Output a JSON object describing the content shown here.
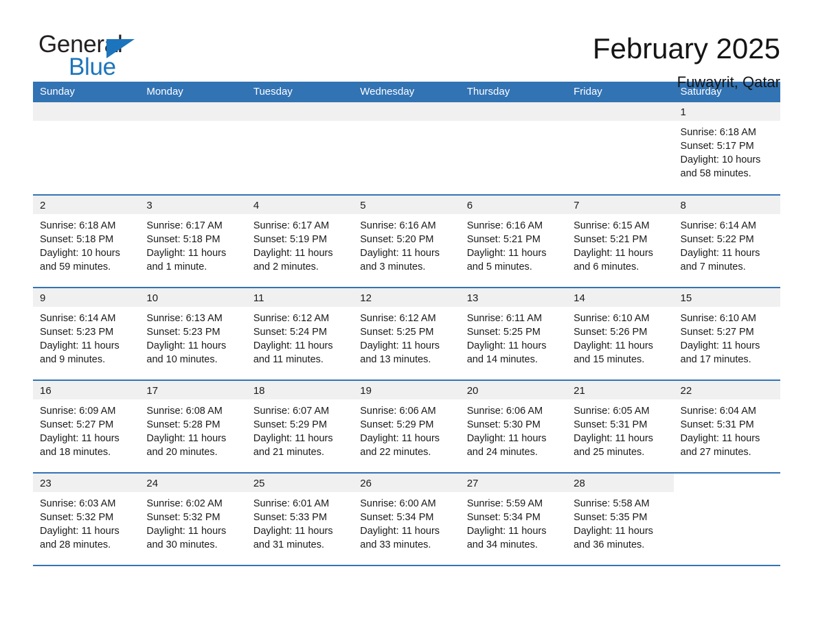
{
  "logo": {
    "word_top": "General",
    "word_bottom": "Blue",
    "accent_color": "#1c75bc"
  },
  "header": {
    "month_title": "February 2025",
    "location": "Fuwayrit, Qatar"
  },
  "theme": {
    "header_blue": "#3273b4",
    "daynum_band": "#f0f0f0",
    "text": "#1a1a1a"
  },
  "weekday_headers": [
    "Sunday",
    "Monday",
    "Tuesday",
    "Wednesday",
    "Thursday",
    "Friday",
    "Saturday"
  ],
  "weeks": [
    [
      {
        "day": "",
        "sunrise": "",
        "sunset": "",
        "daylight_line1": "",
        "daylight_line2": ""
      },
      {
        "day": "",
        "sunrise": "",
        "sunset": "",
        "daylight_line1": "",
        "daylight_line2": ""
      },
      {
        "day": "",
        "sunrise": "",
        "sunset": "",
        "daylight_line1": "",
        "daylight_line2": ""
      },
      {
        "day": "",
        "sunrise": "",
        "sunset": "",
        "daylight_line1": "",
        "daylight_line2": ""
      },
      {
        "day": "",
        "sunrise": "",
        "sunset": "",
        "daylight_line1": "",
        "daylight_line2": ""
      },
      {
        "day": "",
        "sunrise": "",
        "sunset": "",
        "daylight_line1": "",
        "daylight_line2": ""
      },
      {
        "day": "1",
        "sunrise": "Sunrise: 6:18 AM",
        "sunset": "Sunset: 5:17 PM",
        "daylight_line1": "Daylight: 10 hours",
        "daylight_line2": "and 58 minutes."
      }
    ],
    [
      {
        "day": "2",
        "sunrise": "Sunrise: 6:18 AM",
        "sunset": "Sunset: 5:18 PM",
        "daylight_line1": "Daylight: 10 hours",
        "daylight_line2": "and 59 minutes."
      },
      {
        "day": "3",
        "sunrise": "Sunrise: 6:17 AM",
        "sunset": "Sunset: 5:18 PM",
        "daylight_line1": "Daylight: 11 hours",
        "daylight_line2": "and 1 minute."
      },
      {
        "day": "4",
        "sunrise": "Sunrise: 6:17 AM",
        "sunset": "Sunset: 5:19 PM",
        "daylight_line1": "Daylight: 11 hours",
        "daylight_line2": "and 2 minutes."
      },
      {
        "day": "5",
        "sunrise": "Sunrise: 6:16 AM",
        "sunset": "Sunset: 5:20 PM",
        "daylight_line1": "Daylight: 11 hours",
        "daylight_line2": "and 3 minutes."
      },
      {
        "day": "6",
        "sunrise": "Sunrise: 6:16 AM",
        "sunset": "Sunset: 5:21 PM",
        "daylight_line1": "Daylight: 11 hours",
        "daylight_line2": "and 5 minutes."
      },
      {
        "day": "7",
        "sunrise": "Sunrise: 6:15 AM",
        "sunset": "Sunset: 5:21 PM",
        "daylight_line1": "Daylight: 11 hours",
        "daylight_line2": "and 6 minutes."
      },
      {
        "day": "8",
        "sunrise": "Sunrise: 6:14 AM",
        "sunset": "Sunset: 5:22 PM",
        "daylight_line1": "Daylight: 11 hours",
        "daylight_line2": "and 7 minutes."
      }
    ],
    [
      {
        "day": "9",
        "sunrise": "Sunrise: 6:14 AM",
        "sunset": "Sunset: 5:23 PM",
        "daylight_line1": "Daylight: 11 hours",
        "daylight_line2": "and 9 minutes."
      },
      {
        "day": "10",
        "sunrise": "Sunrise: 6:13 AM",
        "sunset": "Sunset: 5:23 PM",
        "daylight_line1": "Daylight: 11 hours",
        "daylight_line2": "and 10 minutes."
      },
      {
        "day": "11",
        "sunrise": "Sunrise: 6:12 AM",
        "sunset": "Sunset: 5:24 PM",
        "daylight_line1": "Daylight: 11 hours",
        "daylight_line2": "and 11 minutes."
      },
      {
        "day": "12",
        "sunrise": "Sunrise: 6:12 AM",
        "sunset": "Sunset: 5:25 PM",
        "daylight_line1": "Daylight: 11 hours",
        "daylight_line2": "and 13 minutes."
      },
      {
        "day": "13",
        "sunrise": "Sunrise: 6:11 AM",
        "sunset": "Sunset: 5:25 PM",
        "daylight_line1": "Daylight: 11 hours",
        "daylight_line2": "and 14 minutes."
      },
      {
        "day": "14",
        "sunrise": "Sunrise: 6:10 AM",
        "sunset": "Sunset: 5:26 PM",
        "daylight_line1": "Daylight: 11 hours",
        "daylight_line2": "and 15 minutes."
      },
      {
        "day": "15",
        "sunrise": "Sunrise: 6:10 AM",
        "sunset": "Sunset: 5:27 PM",
        "daylight_line1": "Daylight: 11 hours",
        "daylight_line2": "and 17 minutes."
      }
    ],
    [
      {
        "day": "16",
        "sunrise": "Sunrise: 6:09 AM",
        "sunset": "Sunset: 5:27 PM",
        "daylight_line1": "Daylight: 11 hours",
        "daylight_line2": "and 18 minutes."
      },
      {
        "day": "17",
        "sunrise": "Sunrise: 6:08 AM",
        "sunset": "Sunset: 5:28 PM",
        "daylight_line1": "Daylight: 11 hours",
        "daylight_line2": "and 20 minutes."
      },
      {
        "day": "18",
        "sunrise": "Sunrise: 6:07 AM",
        "sunset": "Sunset: 5:29 PM",
        "daylight_line1": "Daylight: 11 hours",
        "daylight_line2": "and 21 minutes."
      },
      {
        "day": "19",
        "sunrise": "Sunrise: 6:06 AM",
        "sunset": "Sunset: 5:29 PM",
        "daylight_line1": "Daylight: 11 hours",
        "daylight_line2": "and 22 minutes."
      },
      {
        "day": "20",
        "sunrise": "Sunrise: 6:06 AM",
        "sunset": "Sunset: 5:30 PM",
        "daylight_line1": "Daylight: 11 hours",
        "daylight_line2": "and 24 minutes."
      },
      {
        "day": "21",
        "sunrise": "Sunrise: 6:05 AM",
        "sunset": "Sunset: 5:31 PM",
        "daylight_line1": "Daylight: 11 hours",
        "daylight_line2": "and 25 minutes."
      },
      {
        "day": "22",
        "sunrise": "Sunrise: 6:04 AM",
        "sunset": "Sunset: 5:31 PM",
        "daylight_line1": "Daylight: 11 hours",
        "daylight_line2": "and 27 minutes."
      }
    ],
    [
      {
        "day": "23",
        "sunrise": "Sunrise: 6:03 AM",
        "sunset": "Sunset: 5:32 PM",
        "daylight_line1": "Daylight: 11 hours",
        "daylight_line2": "and 28 minutes."
      },
      {
        "day": "24",
        "sunrise": "Sunrise: 6:02 AM",
        "sunset": "Sunset: 5:32 PM",
        "daylight_line1": "Daylight: 11 hours",
        "daylight_line2": "and 30 minutes."
      },
      {
        "day": "25",
        "sunrise": "Sunrise: 6:01 AM",
        "sunset": "Sunset: 5:33 PM",
        "daylight_line1": "Daylight: 11 hours",
        "daylight_line2": "and 31 minutes."
      },
      {
        "day": "26",
        "sunrise": "Sunrise: 6:00 AM",
        "sunset": "Sunset: 5:34 PM",
        "daylight_line1": "Daylight: 11 hours",
        "daylight_line2": "and 33 minutes."
      },
      {
        "day": "27",
        "sunrise": "Sunrise: 5:59 AM",
        "sunset": "Sunset: 5:34 PM",
        "daylight_line1": "Daylight: 11 hours",
        "daylight_line2": "and 34 minutes."
      },
      {
        "day": "28",
        "sunrise": "Sunrise: 5:58 AM",
        "sunset": "Sunset: 5:35 PM",
        "daylight_line1": "Daylight: 11 hours",
        "daylight_line2": "and 36 minutes."
      },
      {
        "day": "",
        "sunrise": "",
        "sunset": "",
        "daylight_line1": "",
        "daylight_line2": ""
      }
    ]
  ]
}
